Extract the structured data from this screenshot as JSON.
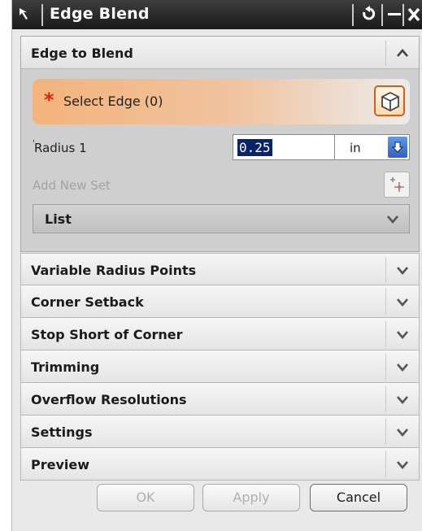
{
  "window": {
    "title": "Edge Blend",
    "cursor_icon": "select-cursor-icon",
    "reset_icon": "reset-icon",
    "minimize_icon": "minimize-icon",
    "close_icon": "close-icon"
  },
  "edge_to_blend": {
    "title": "Edge to Blend",
    "collapse_icon": "chevron-up-icon",
    "select_edge": {
      "required_marker": "*",
      "label": "Select Edge (0)",
      "icon": "cube-select-icon"
    },
    "radius": {
      "label": "Radius 1",
      "marker": "'",
      "value": "0.25",
      "unit": "in",
      "unit_icon": "dropdown-arrow-icon"
    },
    "add_new_set": {
      "label": "Add New Set",
      "icon": "add-set-icon"
    },
    "list": {
      "title": "List",
      "icon": "chevron-down-icon"
    }
  },
  "sections": [
    {
      "title": "Variable Radius Points"
    },
    {
      "title": "Corner Setback"
    },
    {
      "title": "Stop Short of Corner"
    },
    {
      "title": "Trimming"
    },
    {
      "title": "Overflow Resolutions"
    },
    {
      "title": "Settings"
    },
    {
      "title": "Preview"
    }
  ],
  "buttons": {
    "ok": "OK",
    "apply": "Apply",
    "cancel": "Cancel"
  },
  "colors": {
    "titlebar": "#1a1a1a",
    "select_highlight": "#f3b37b",
    "required_star": "#e2220e",
    "value_selection": "#0a246a",
    "dropdown_button": "#2f62c2"
  }
}
